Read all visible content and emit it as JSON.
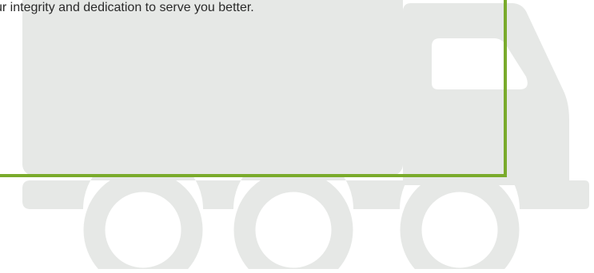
{
  "content": {
    "caption": "ur integrity and dedication to serve you better."
  },
  "illustration": {
    "icon": "truck-icon",
    "truck_color": "#e6e8e6",
    "window_color": "#ffffff",
    "accent_frame_color": "#7aab2c"
  }
}
